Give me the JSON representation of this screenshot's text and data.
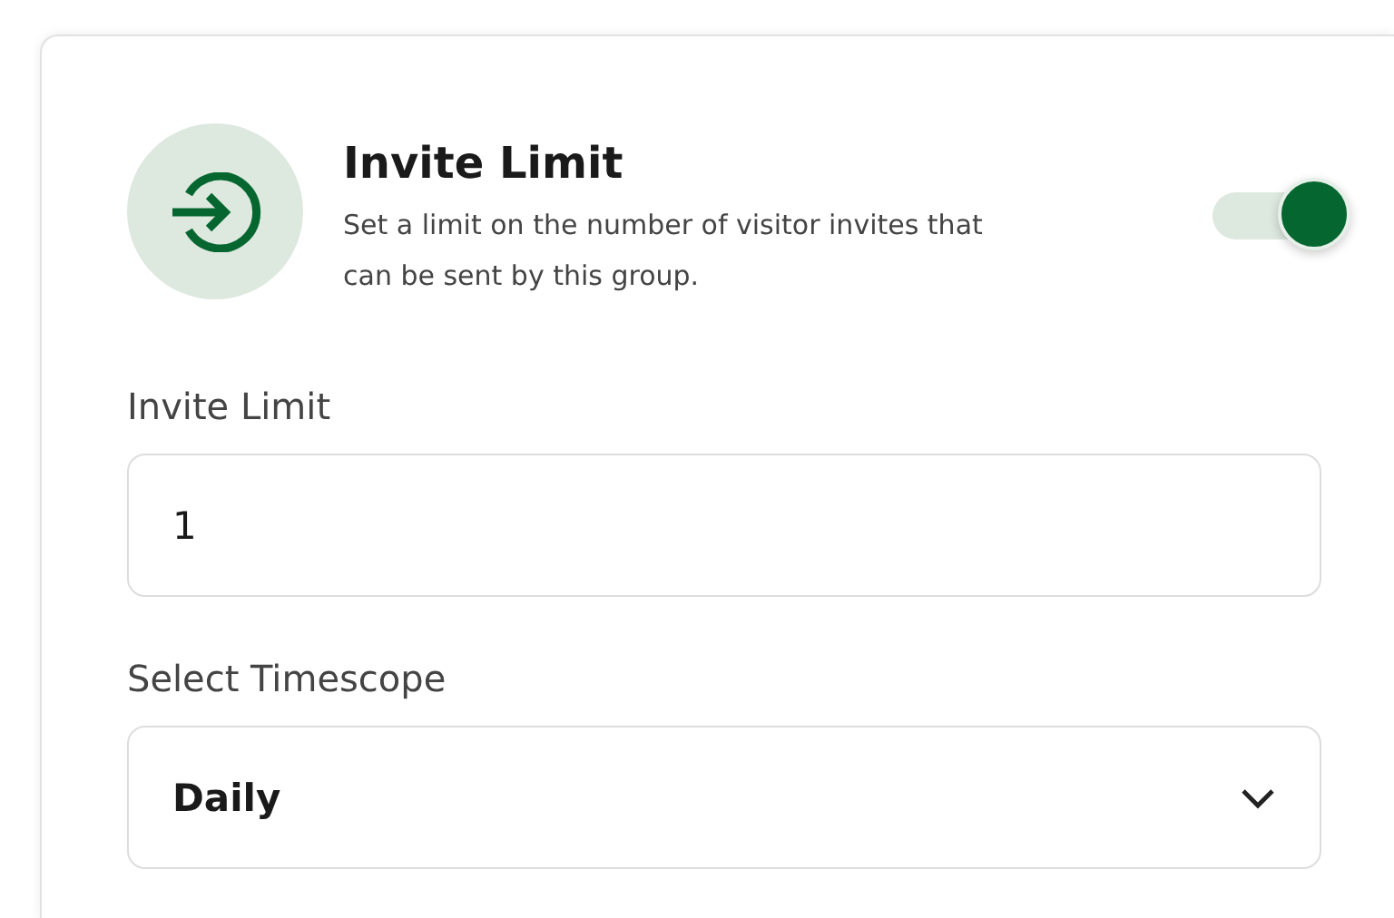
{
  "header": {
    "title": "Invite Limit",
    "description": "Set a limit on the number of visitor invites that can be sent by this group.",
    "toggle": {
      "on": true
    }
  },
  "fields": [
    {
      "kind": "input",
      "label": "Invite Limit",
      "value": "1"
    },
    {
      "kind": "select",
      "label": "Select Timescope",
      "value": "Daily"
    }
  ]
}
